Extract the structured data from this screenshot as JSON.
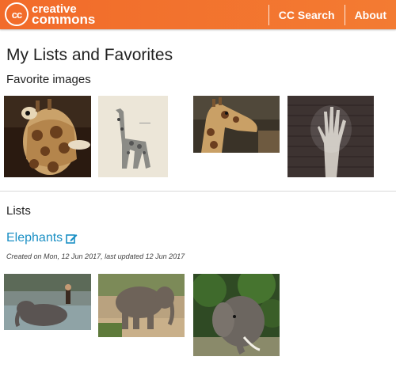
{
  "header": {
    "logo_mark": "cc",
    "logo_line1": "creative",
    "logo_line2": "commons",
    "nav": [
      "CC Search",
      "About"
    ]
  },
  "page": {
    "title": "My Lists and Favorites",
    "favorites_heading": "Favorite images",
    "lists_heading": "Lists"
  },
  "favorites": [
    {
      "subject": "giraffe close-up face"
    },
    {
      "subject": "giraffe illustration on paper"
    },
    {
      "subject": "giraffe head and neck"
    },
    {
      "subject": "hand graffiti on brick wall"
    }
  ],
  "lists": [
    {
      "name": "Elephants",
      "meta": "Created on Mon, 12 Jun 2017, last updated 12 Jun 2017",
      "images": [
        {
          "subject": "elephant bathing in river"
        },
        {
          "subject": "elephant in zoo enclosure"
        },
        {
          "subject": "elephant with tusks among trees"
        }
      ]
    }
  ],
  "icons": {
    "edit": "edit-icon",
    "logo": "cc-logo-icon"
  },
  "colors": {
    "header": "#f26b2a",
    "link": "#1a8fc4"
  }
}
